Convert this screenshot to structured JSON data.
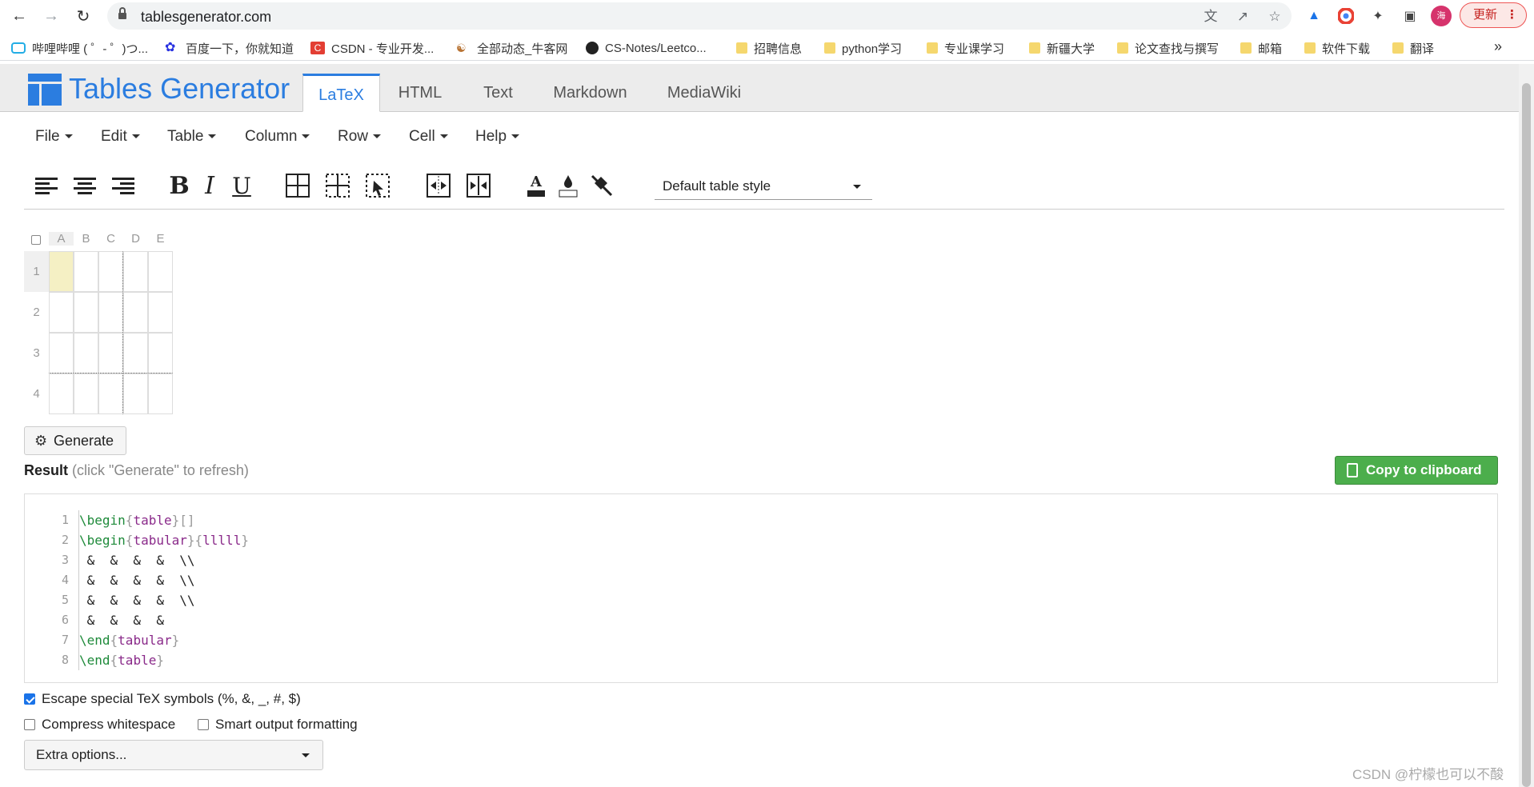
{
  "browser": {
    "url": "tablesgenerator.com",
    "avatar_label": "海",
    "update_label": "更新",
    "bookmarks": [
      {
        "label": "哔哩哔哩 ( ゜- ゜)つ...",
        "icon": "bilibili-icon"
      },
      {
        "label": "百度一下，你就知道",
        "icon": "baidu-icon"
      },
      {
        "label": "CSDN - 专业开发...",
        "icon": "csdn-icon"
      },
      {
        "label": "全部动态_牛客网",
        "icon": "nowcoder-icon"
      },
      {
        "label": "CS-Notes/Leetco...",
        "icon": "github-icon"
      },
      {
        "label": "招聘信息",
        "icon": "folder-icon"
      },
      {
        "label": "python学习",
        "icon": "folder-icon"
      },
      {
        "label": "专业课学习",
        "icon": "folder-icon"
      },
      {
        "label": "新疆大学",
        "icon": "folder-icon"
      },
      {
        "label": "论文查找与撰写",
        "icon": "folder-icon"
      },
      {
        "label": "邮箱",
        "icon": "folder-icon"
      },
      {
        "label": "软件下载",
        "icon": "folder-icon"
      },
      {
        "label": "翻译",
        "icon": "folder-icon"
      }
    ],
    "more": "»"
  },
  "app": {
    "logo": "Tables Generator",
    "tabs": [
      "LaTeX",
      "HTML",
      "Text",
      "Markdown",
      "MediaWiki"
    ],
    "active_tab": "LaTeX",
    "menus": [
      "File",
      "Edit",
      "Table",
      "Column",
      "Row",
      "Cell",
      "Help"
    ],
    "table_style": "Default table style",
    "grid": {
      "columns": [
        "A",
        "B",
        "C",
        "D",
        "E"
      ],
      "rows": [
        "1",
        "2",
        "3",
        "4"
      ]
    },
    "generate_label": "Generate",
    "result_label": "Result",
    "result_hint": "(click \"Generate\" to refresh)",
    "copy_label": "Copy to clipboard",
    "code_lines": [
      {
        "n": "1",
        "text": "\\begin{table}[]"
      },
      {
        "n": "2",
        "text": "\\begin{tabular}{lllll}"
      },
      {
        "n": "3",
        "text": " &  &  &  &  \\\\"
      },
      {
        "n": "4",
        "text": " &  &  &  &  \\\\"
      },
      {
        "n": "5",
        "text": " &  &  &  &  \\\\"
      },
      {
        "n": "6",
        "text": " &  &  &  &"
      },
      {
        "n": "7",
        "text": "\\end{tabular}"
      },
      {
        "n": "8",
        "text": "\\end{table}"
      }
    ],
    "options": {
      "escape": {
        "label": "Escape special TeX symbols (%, &, _, #, $)",
        "checked": true
      },
      "compress": {
        "label": "Compress whitespace",
        "checked": false
      },
      "smart": {
        "label": "Smart output formatting",
        "checked": false
      }
    },
    "extra_options": "Extra options..."
  },
  "watermark": "CSDN @柠檬也可以不酸",
  "colors": {
    "brand": "#2b7de0",
    "copy": "#4cae4c"
  }
}
